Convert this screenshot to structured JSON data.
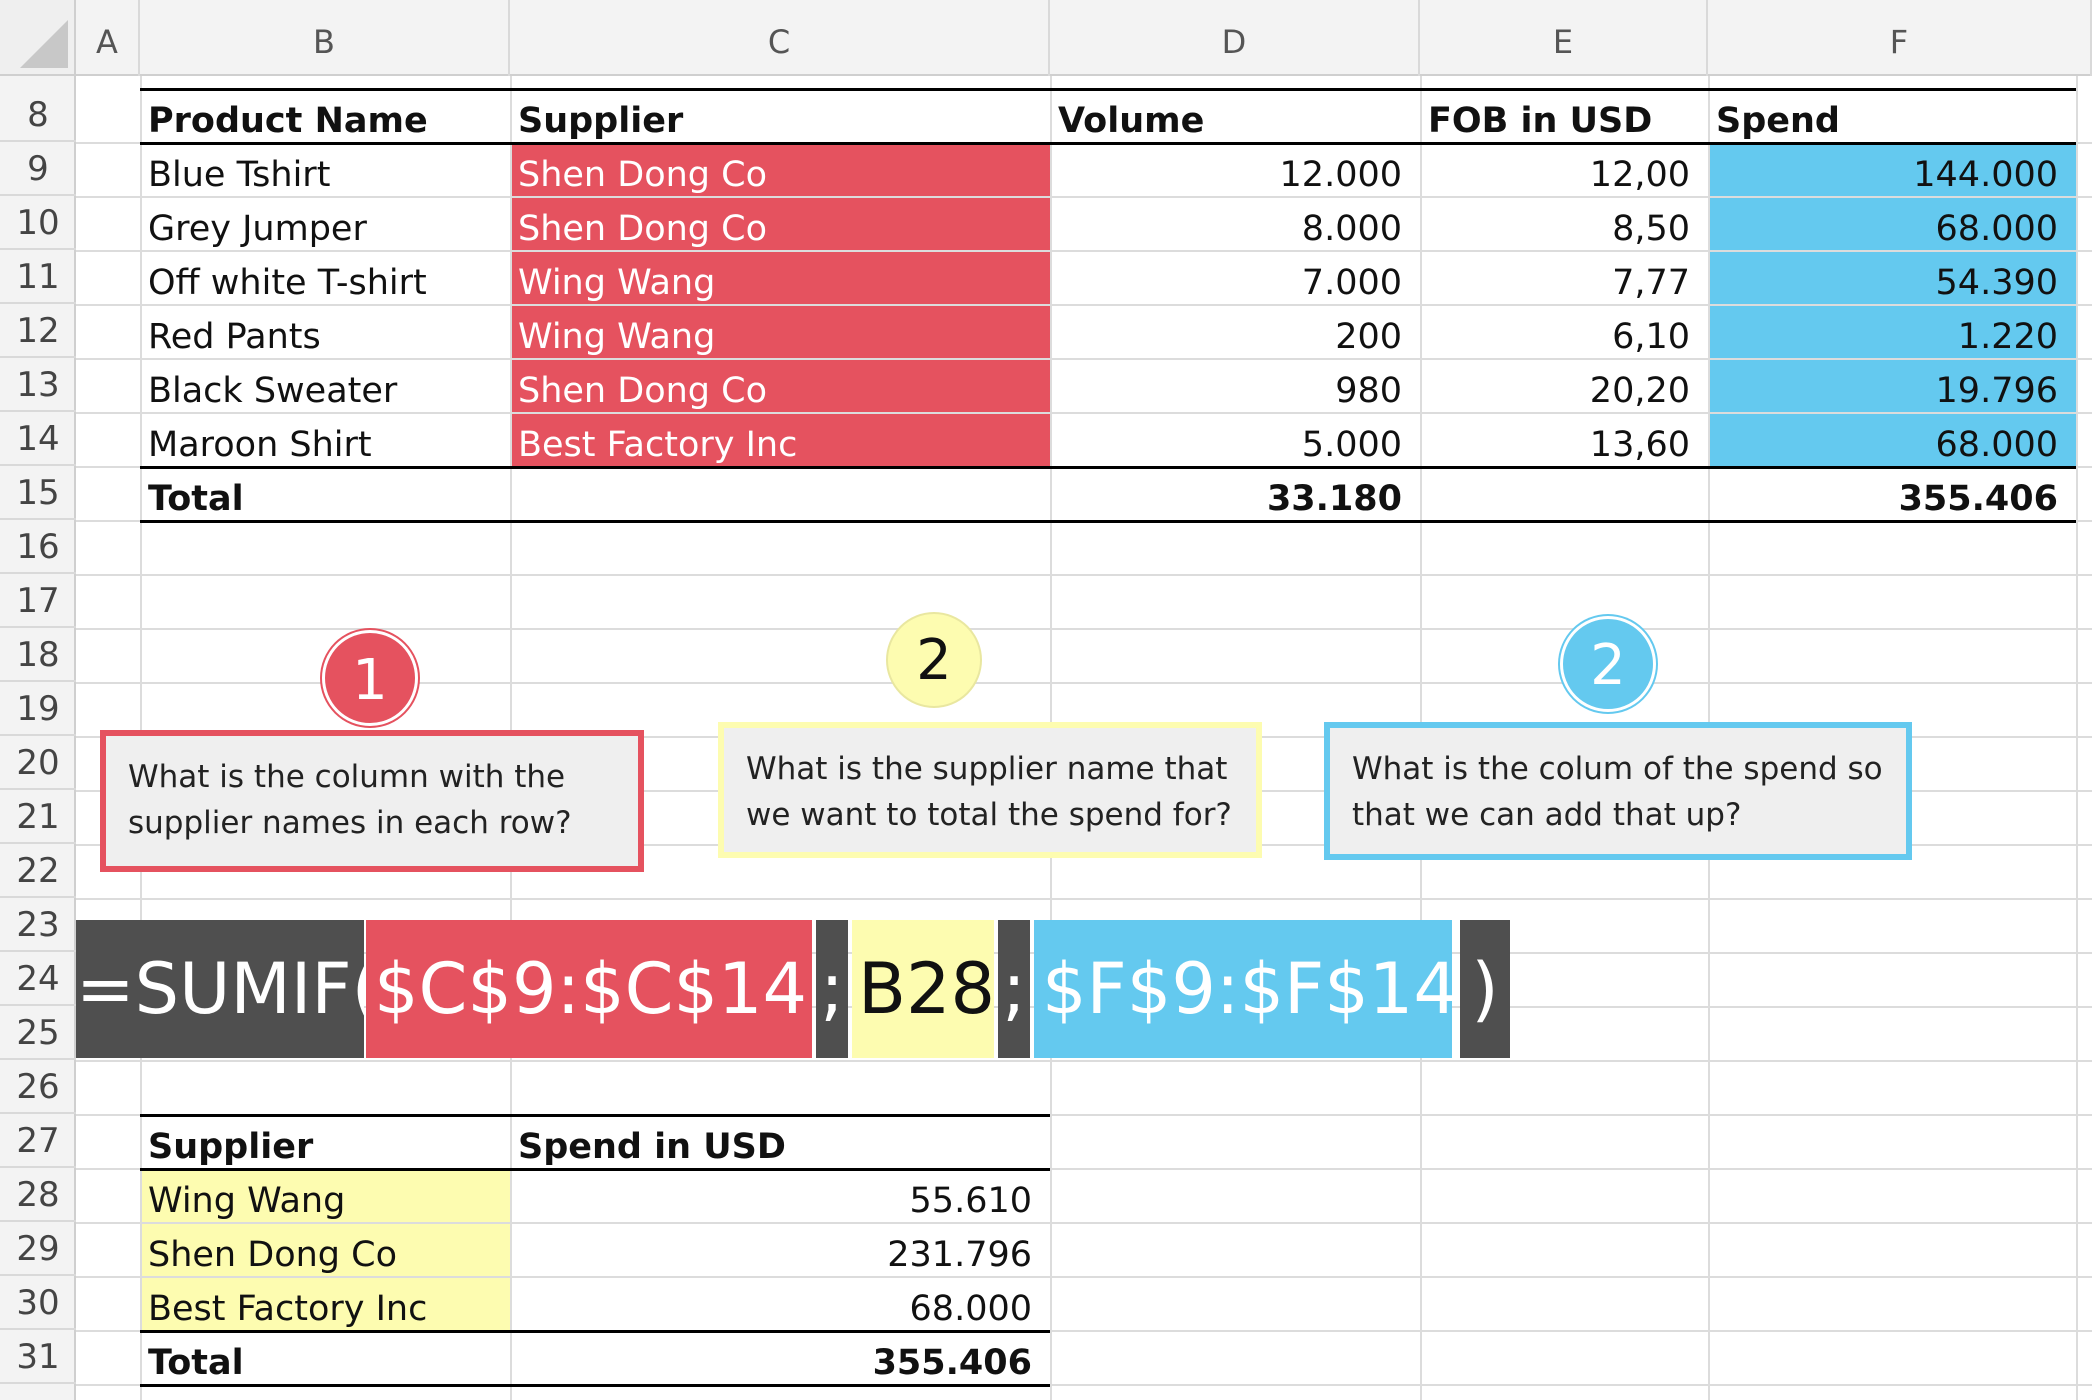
{
  "columns": [
    "A",
    "B",
    "C",
    "D",
    "E",
    "F"
  ],
  "rows": [
    "8",
    "9",
    "10",
    "11",
    "12",
    "13",
    "14",
    "15",
    "16",
    "17",
    "18",
    "19",
    "20",
    "21",
    "22",
    "23",
    "24",
    "25",
    "26",
    "27",
    "28",
    "29",
    "30",
    "31"
  ],
  "main_table": {
    "headers": [
      "Product Name",
      "Supplier",
      "Volume",
      "FOB in USD",
      "Spend"
    ],
    "rows": [
      [
        "Blue Tshirt",
        "Shen Dong Co",
        "12.000",
        "12,00",
        "144.000"
      ],
      [
        "Grey Jumper",
        "Shen Dong Co",
        "8.000",
        "8,50",
        "68.000"
      ],
      [
        "Off white T-shirt",
        "Wing Wang",
        "7.000",
        "7,77",
        "54.390"
      ],
      [
        "Red Pants",
        "Wing Wang",
        "200",
        "6,10",
        "1.220"
      ],
      [
        "Black Sweater",
        "Shen Dong Co",
        "980",
        "20,20",
        "19.796"
      ],
      [
        "Maroon Shirt",
        "Best Factory Inc",
        "5.000",
        "13,60",
        "68.000"
      ]
    ],
    "total": {
      "label": "Total",
      "volume": "33.180",
      "spend": "355.406"
    }
  },
  "callouts": [
    {
      "number": "1",
      "text_line1": "What is the column with the",
      "text_line2": "supplier names in each row?",
      "color": "#e5525f"
    },
    {
      "number": "2",
      "text_line1": "What is the supplier name that",
      "text_line2": "we want to total the spend for?",
      "color": "#fdfcb0"
    },
    {
      "number": "2",
      "text_line1": "What is the colum of the spend so",
      "text_line2": "that we can add that up?",
      "color": "#64c9ef"
    }
  ],
  "formula": {
    "func": "=SUMIF(",
    "range1": "$C$9:$C$14",
    "sep1": ";",
    "criteria": "B28",
    "sep2": ";",
    "range2": "$F$9:$F$14",
    "close": ")"
  },
  "summary_table": {
    "headers": [
      "Supplier",
      "Spend in USD"
    ],
    "rows": [
      [
        "Wing Wang",
        "55.610"
      ],
      [
        "Shen Dong Co",
        "231.796"
      ],
      [
        "Best Factory Inc",
        "68.000"
      ]
    ],
    "total": {
      "label": "Total",
      "value": "355.406"
    }
  },
  "colors": {
    "red": "#e5525f",
    "yellow": "#fdfcb0",
    "blue": "#64c9ef",
    "dark": "#4f4f4f"
  }
}
